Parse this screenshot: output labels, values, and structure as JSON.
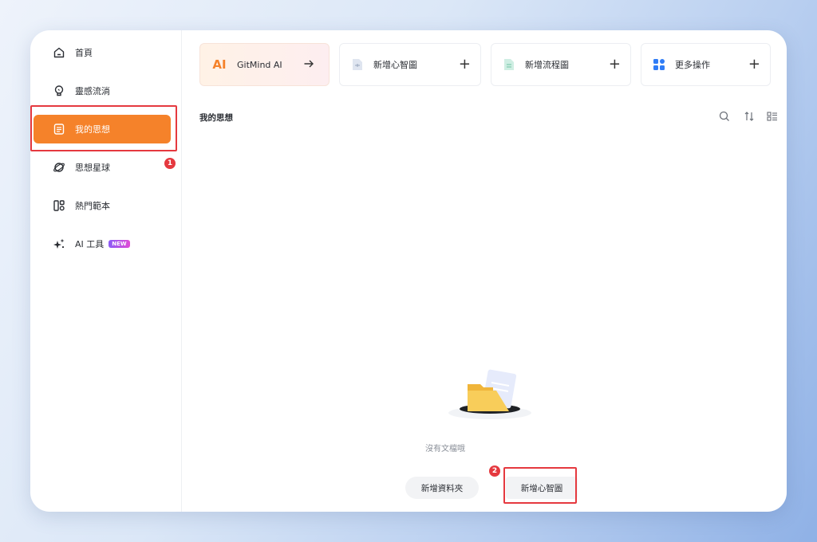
{
  "sidebar": {
    "items": [
      {
        "label": "首頁",
        "icon": "home-icon"
      },
      {
        "label": "靈感流淌",
        "icon": "lightbulb-icon"
      },
      {
        "label": "我的思想",
        "icon": "document-icon"
      },
      {
        "label": "思想星球",
        "icon": "planet-icon"
      },
      {
        "label": "熱門範本",
        "icon": "template-icon"
      },
      {
        "label": "AI 工具",
        "icon": "sparkle-icon",
        "badge": "NEW"
      }
    ]
  },
  "cards": {
    "ai": {
      "label": "GitMind AI",
      "logo": "AI"
    },
    "mindmap": {
      "label": "新增心智圖"
    },
    "flowchart": {
      "label": "新增流程圖"
    },
    "more": {
      "label": "更多操作"
    }
  },
  "main": {
    "title": "我的思想",
    "empty_text": "沒有文檔哦",
    "new_folder_label": "新增資料夾",
    "new_mindmap_label": "新增心智圖"
  },
  "annotations": {
    "step1": "1",
    "step2": "2"
  },
  "colors": {
    "accent": "#f5822a",
    "highlight": "#e5393f"
  }
}
